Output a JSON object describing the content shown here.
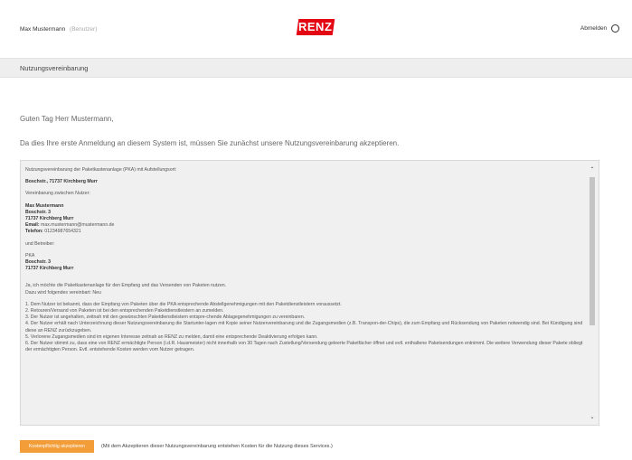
{
  "header": {
    "user_name": "Max Mustermann",
    "user_role": "(Benutzer)",
    "logo_text": "RENZ",
    "logout_label": "Abmelden",
    "logout_icon": "power-icon",
    "brand_color": "#e30613"
  },
  "titlebar": {
    "title": "Nutzungsvereinbarung"
  },
  "main": {
    "greeting": "Guten Tag Herr Mustermann,",
    "intro": "Da dies Ihre erste Anmeldung an diesem System ist, müssen Sie zunächst unsere Nutzungsvereinbarung akzeptieren."
  },
  "agreement": {
    "heading": "Nutzungsvereinbarung der Paketkastenanlage (PKA) mit Aufstellungsort:",
    "location": "Boschstr., 71737 Kirchberg Murr",
    "between_label": "Vereinbarung zwischen Nutzer:",
    "user": {
      "name": "Max Mustermann",
      "street": "Boschstr. 3",
      "city": "71737 Kirchberg Murr",
      "email_label": "Email:",
      "email": "max.mustermann@mustermann.de",
      "phone_label": "Telefon:",
      "phone": "01234987654321"
    },
    "operator_label": "und Betreiber:",
    "operator": {
      "name": "PKA",
      "street": "Boschstr. 3",
      "city": "71737 Kirchberg Murr"
    },
    "intent_1": "Ja, ich möchte die Paketkastenanlage für den Empfang und das Versenden von Paketen nutzen.",
    "intent_2": "Dazu wird folgendes vereinbart: Neu",
    "clauses": [
      "1. Dem Nutzer ist bekannt, dass der Empfang von Paketen über die PKA entsprechende Abstellgenehmigungen mit den Paketdienstleistern voraussetzt.",
      "2. Retouren/Versand von Paketen ist bei den entsprechenden Paketdienstleistern an zumelden.",
      "3. Der Nutzer ist angehalten, zeitnah mit den gewünschten Paketdienstleistern entspre-chende Ablagegenehmigungen zu vereinbaren.",
      "4. Der Nutzer erhält nach Unterzeichnung dieser Nutzungsvereinbarung die Startunter-lagen mit Kopie seiner Nutzervereinbarung und die Zugangsmedien (z.B. Transpon-der-Chips), die zum Empfang und Rücksendung von Paketen notwendig sind. Bei Kündigung sind diese an RENZ zurückzugeben.",
      "5. Verlorene Zugangsmedien sind im eigenen Interesse zeitnah an RENZ zu melden, damit eine entsprechende Deaktivierung erfolgen kann.",
      "6. Der Nutzer stimmt zu, dass eine von RENZ ermächtigte Person (i.d.R. Hausmeister) nicht innerhalb von 30 Tagen nach Zustellung/Versendung geleerte Paketfächer öffnet und evtl. enthaltene Paketsendungen entnimmt. Die weitere Verwendung dieser Pakete obliegt der ermächtigten Person. Evtl. entstehende Kosten werden vom Nutzer getragen."
    ]
  },
  "footer": {
    "accept_label": "Kostenpflichtig akzeptieren",
    "accept_color": "#f29d38",
    "note": "(Mit dem Akzeptieren dieser Nutzungsvereinbarung entstehen Kosten für die Nutzung dieses Services.)"
  }
}
